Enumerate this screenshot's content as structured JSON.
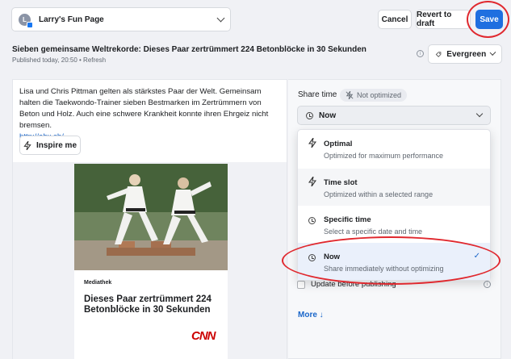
{
  "header": {
    "page_name": "Larry's Fun Page",
    "avatar_letter": "L",
    "cancel_label": "Cancel",
    "revert_label": "Revert to draft",
    "save_label": "Save"
  },
  "post": {
    "title": "Sieben gemeinsame Weltrekorde: Dieses Paar zertrümmert 224 Betonblöcke in 30 Sekunden",
    "meta": "Published today, 20:50 • Refresh",
    "evergreen_label": "Evergreen",
    "text": "Lisa und Chris Pittman gelten als stärkstes Paar der Welt. Gemeinsam halten die Taekwondo-Trainer sieben Bestmarken im Zertrümmern von Beton und Holz. Auch eine schwere Krankheit konnte ihren Ehrgeiz nicht bremsen.",
    "link": "http://ebx.sh/...",
    "inspire_label": "Inspire me"
  },
  "card": {
    "source_label": "Mediathek",
    "headline": "Dieses Paar zertrümmert 224 Betonblöcke in 30 Sekunden",
    "brand": "CNN"
  },
  "share": {
    "label": "Share time",
    "badge": "Not optimized",
    "selected": "Now",
    "options": [
      {
        "title": "Optimal",
        "desc": "Optimized for maximum performance",
        "icon": "bolt-icon"
      },
      {
        "title": "Time slot",
        "desc": "Optimized within a selected range",
        "icon": "bolt-icon"
      },
      {
        "title": "Specific time",
        "desc": "Select a specific date and time",
        "icon": "clock-icon"
      },
      {
        "title": "Now",
        "desc": "Share immediately without optimizing",
        "icon": "clock-icon"
      }
    ],
    "update_label": "Update before publishing",
    "more_label": "More ↓"
  },
  "colors": {
    "accent": "#1f6fe0",
    "annotation": "#e0282e"
  }
}
